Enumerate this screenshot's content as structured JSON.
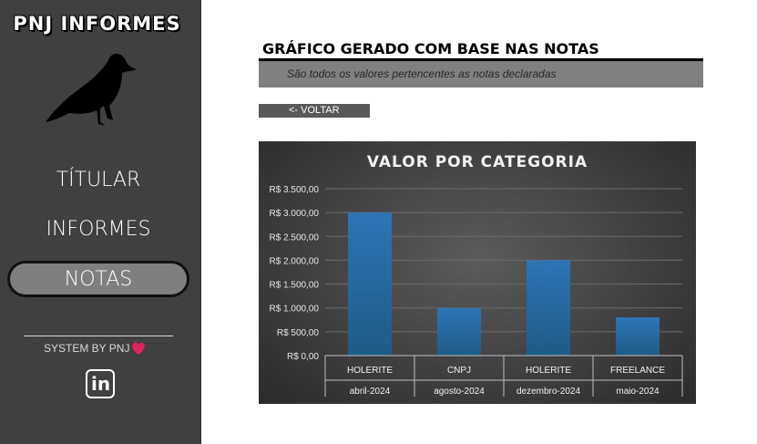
{
  "sidebar": {
    "brand": "PNJ INFORMES",
    "nav": {
      "titular": "TÍTULAR",
      "informes": "INFORMES",
      "notas": "NOTAS"
    },
    "footer": "SYSTEM BY PNJ"
  },
  "main": {
    "title": "GRÁFICO GERADO COM BASE NAS NOTAS",
    "subtitle": "São todos os valores pertencentes as notas declaradas",
    "back_button": "<- VOLTAR"
  },
  "chart_data": {
    "type": "bar",
    "title": "VALOR POR CATEGORIA",
    "categories": [
      {
        "label": "HOLERITE",
        "period": "abril-2024"
      },
      {
        "label": "CNPJ",
        "period": "agosto-2024"
      },
      {
        "label": "HOLERITE",
        "period": "dezembro-2024"
      },
      {
        "label": "FREELANCE",
        "period": "maio-2024"
      }
    ],
    "values": [
      3000,
      1000,
      2000,
      800
    ],
    "ylim": [
      0,
      3500
    ],
    "yticks": [
      "R$ 0,00",
      "R$ 500,00",
      "R$ 1.000,00",
      "R$ 1.500,00",
      "R$ 2.000,00",
      "R$ 2.500,00",
      "R$ 3.000,00",
      "R$ 3.500,00"
    ],
    "ytick_values": [
      0,
      500,
      1000,
      1500,
      2000,
      2500,
      3000,
      3500
    ],
    "grid": true,
    "bar_color_top": "#2e75b6",
    "bar_color_bottom": "#1f5b86"
  }
}
